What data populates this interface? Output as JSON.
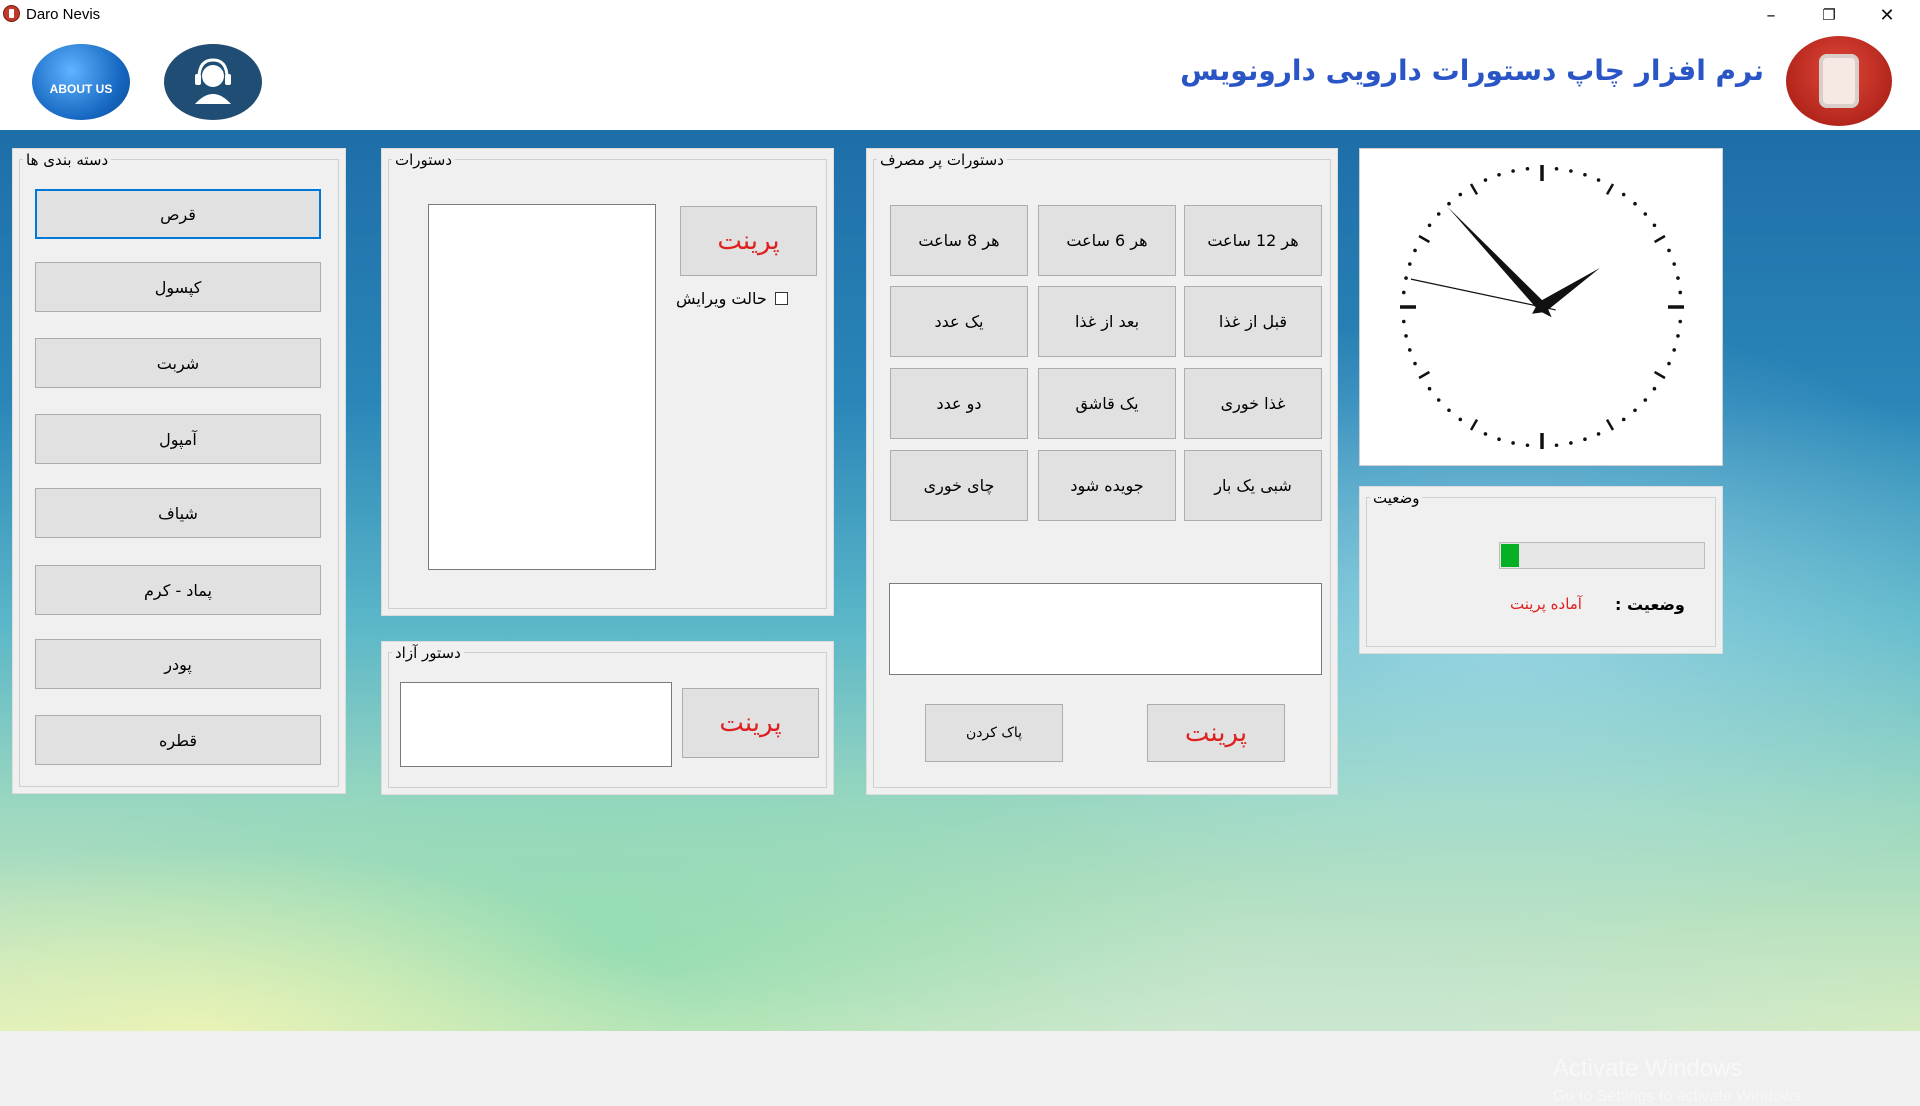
{
  "window": {
    "title": "Daro Nevis"
  },
  "header": {
    "about_label": "ABOUT US",
    "app_title": "نرم افزار چاپ دستورات دارویی دارونویس"
  },
  "categories": {
    "legend": "دسته بندی ها",
    "items": [
      "قرص",
      "کپسول",
      "شربت",
      "آمپول",
      "شیاف",
      "پماد - کرم",
      "پودر",
      "قطره"
    ]
  },
  "instructions": {
    "legend": "دستورات",
    "print_label": "پرینت",
    "edit_mode_label": "حالت ویرایش",
    "edit_mode_checked": false
  },
  "free_instruction": {
    "legend": "دستور آزاد",
    "print_label": "پرینت",
    "value": ""
  },
  "frequent": {
    "legend": "دستورات پر مصرف",
    "buttons": [
      "هر 12 ساعت",
      "هر 6 ساعت",
      "هر 8 ساعت",
      "قبل از غذا",
      "بعد از غذا",
      "یک عدد",
      "غذا خوری",
      "یک قاشق",
      "دو عدد",
      "شبی یک بار",
      "جویده شود",
      "چای خوری"
    ],
    "output_value": "",
    "clear_label": "پاک کردن",
    "print_label": "پرینت"
  },
  "clock": {
    "hour": 1,
    "minute": 52,
    "second": 47
  },
  "status": {
    "legend": "وضعیت",
    "label": "وضعیت :",
    "value": "آماده پرینت",
    "value_color": "#e02020",
    "progress_fraction": 0.09,
    "progress_color": "#06b025"
  },
  "watermark": {
    "line1": "Activate Windows",
    "line2": "Go to Settings to activate Windows."
  }
}
